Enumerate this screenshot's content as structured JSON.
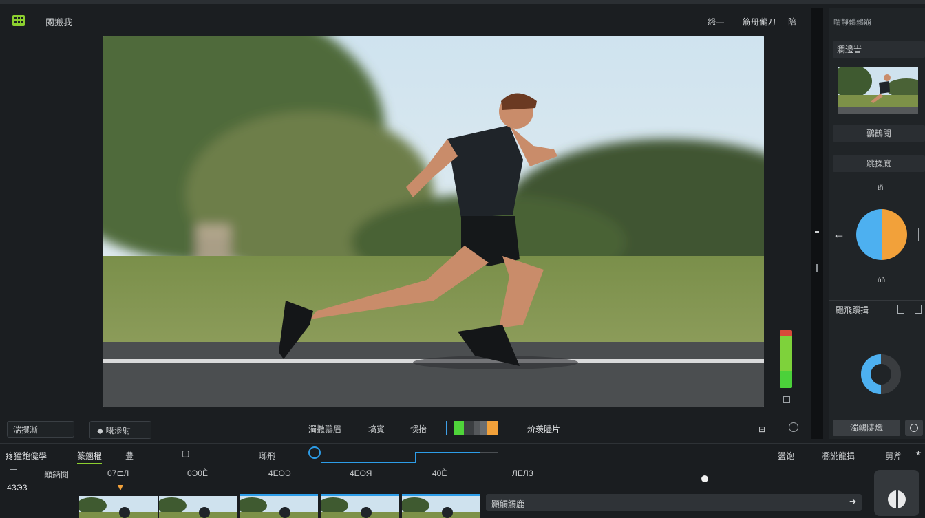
{
  "header": {
    "project_title": "閱搬我",
    "undo_label": "怨—",
    "render_label": "筋册儱刀",
    "layout_label": "陪"
  },
  "preview": {
    "toolbar_labels": [
      "濁撒鶸眉",
      "塙賓",
      "惯抬"
    ],
    "color_label": "炌羡贐片",
    "left_box": "湍攫澌",
    "left_button": "嘅滲射",
    "zoom_label": "一⊟ 一"
  },
  "right_panel": {
    "title": "喟靜鶸鶸崩",
    "media_label": "瀾邊旹",
    "thumb_button": "鶸鵲閱",
    "effects_label": "跳掇廐",
    "wheel_top": "ŧñ",
    "wheel_bottom": "ńñ",
    "section_label": "颺飛躓揖",
    "bottom_button": "濁鶸陡熾",
    "colors": {
      "blue": "#4db0f0",
      "orange": "#f2a13a",
      "dark": "#3a3d40"
    }
  },
  "timeline": {
    "tabs": [
      "疼獞飽儳學",
      "篆翹櫂",
      "豊",
      "▢",
      "瑯飛"
    ],
    "right_labels": [
      "盪饱",
      "凞誮龍揖",
      "舅斧"
    ],
    "time_labels": [
      "顚鈵閱",
      "07⊏Л",
      "0Э0Ѐ",
      "4ЕОЭ",
      "4ЕОЯ",
      "40Ѐ",
      "ЛЕЛЗ"
    ],
    "track_name": "顥觸觸鹿",
    "track_count": "4ЗЭЗ",
    "meter_value": 0.92,
    "playhead_label": "▼"
  }
}
